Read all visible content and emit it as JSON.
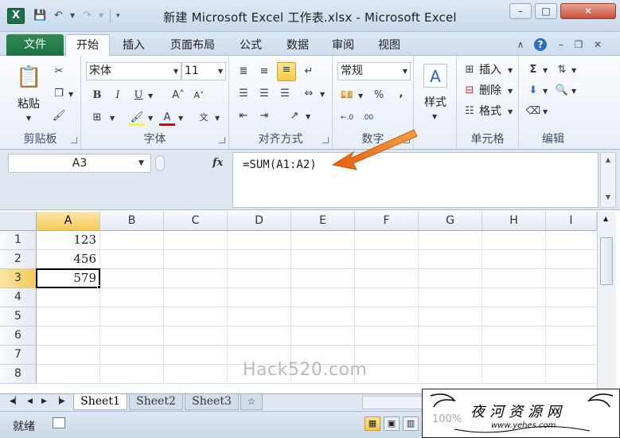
{
  "window": {
    "title": "新建 Microsoft Excel 工作表.xlsx - Microsoft Excel",
    "app_icon": "X"
  },
  "ribbon_tabs": {
    "file": "文件",
    "items": [
      "开始",
      "插入",
      "页面布局",
      "公式",
      "数据",
      "审阅",
      "视图"
    ],
    "active": "开始"
  },
  "clipboard": {
    "paste": "粘贴",
    "label": "剪贴板"
  },
  "font": {
    "name": "宋体",
    "size": "11",
    "label": "字体"
  },
  "alignment": {
    "label": "对齐方式"
  },
  "number": {
    "format": "常规",
    "percent": "%",
    "comma": ",",
    "label": "数字"
  },
  "styles": {
    "label": "样式"
  },
  "cells": {
    "insert": "插入",
    "delete": "删除",
    "format": "格式",
    "label": "单元格"
  },
  "editing": {
    "sigma": "Σ",
    "label": "编辑"
  },
  "formula_bar": {
    "name_box": "A3",
    "fx": "fx",
    "formula": "=SUM(A1:A2)"
  },
  "grid": {
    "columns": [
      "A",
      "B",
      "C",
      "D",
      "E",
      "F",
      "G",
      "H",
      "I"
    ],
    "rows": [
      "1",
      "2",
      "3",
      "4",
      "5",
      "6",
      "7",
      "8"
    ],
    "cells": {
      "A1": "123",
      "A2": "456",
      "A3": "579"
    },
    "selected": "A3"
  },
  "watermark": "Hack520.com",
  "sheets": [
    "Sheet1",
    "Sheet2",
    "Sheet3"
  ],
  "active_sheet": "Sheet1",
  "status": {
    "ready": "就绪",
    "zoom": "100%"
  },
  "logo": {
    "text": "夜河资源网",
    "url": "www.yehes.com"
  },
  "colors": {
    "accent": "#1e7145",
    "arrow": "#f07b1f",
    "selected_header": "#f5c95a"
  }
}
